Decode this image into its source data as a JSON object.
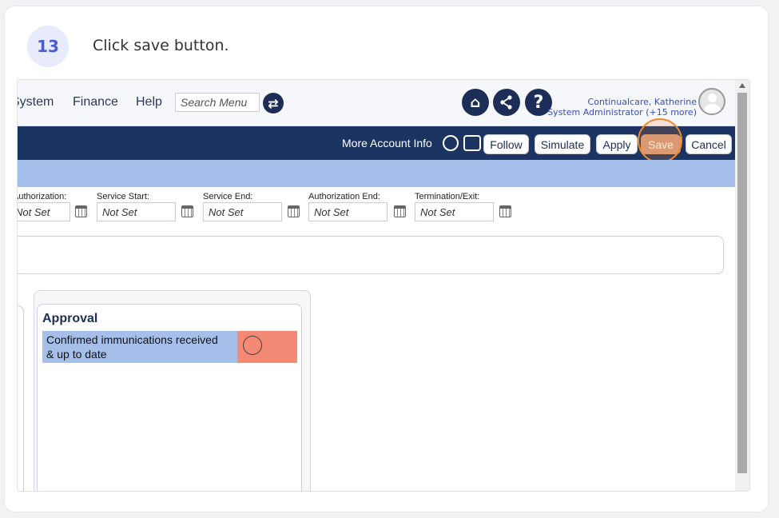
{
  "guide": {
    "step_number": "13",
    "instruction": "Click save button."
  },
  "menu": {
    "system": "System",
    "finance": "Finance",
    "help": "Help",
    "search_placeholder": "Search Menu"
  },
  "user": {
    "name": "Continualcare, Katherine",
    "role": "System Administrator (+15 more)"
  },
  "nav": {
    "more_account_info": "More Account Info",
    "follow": "Follow",
    "simulate": "Simulate",
    "apply": "Apply",
    "save": "Save",
    "cancel": "Cancel"
  },
  "fields": [
    {
      "label": "Authorization:",
      "value": "Not Set"
    },
    {
      "label": "Service Start:",
      "value": "Not Set"
    },
    {
      "label": "Service End:",
      "value": "Not Set"
    },
    {
      "label": "Authorization End:",
      "value": "Not Set"
    },
    {
      "label": "Termination/Exit:",
      "value": "Not Set"
    }
  ],
  "approval": {
    "title": "Approval",
    "item_line1": "Confirmed immunications received",
    "item_line2": "& up to date"
  },
  "colors": {
    "navbar": "#1c3461",
    "bluebar": "#a6bfea",
    "save_button": "#d59d81",
    "highlight": "#f28a2e",
    "status_red": "#f48a75"
  }
}
